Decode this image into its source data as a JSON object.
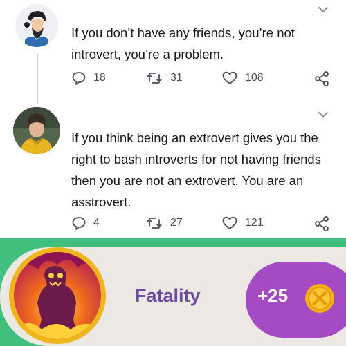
{
  "tweets": [
    {
      "avatar_icon": "bearded-man-avatar",
      "text": "If you don’t have any friends, you’re not introvert, you’re a problem.",
      "replies": "18",
      "retweets": "31",
      "likes": "108"
    },
    {
      "avatar_icon": "person-yellow-jacket-avatar",
      "text": "If you think being an extrovert gives you the right to bash introverts for not having friends then you are not an extrovert. You are an asstrovert.",
      "replies": "4",
      "retweets": "27",
      "likes": "121"
    }
  ],
  "banner": {
    "label": "Fatality",
    "score": "+25",
    "badge_icon": "fire-monster-badge",
    "coin_icon": "gold-coin-icon",
    "colors": {
      "accent_green": "#3fc07d",
      "pill_purple": "#a44ac2",
      "label_purple": "#6c4ba0",
      "badge_gold": "#f1b51c"
    }
  }
}
